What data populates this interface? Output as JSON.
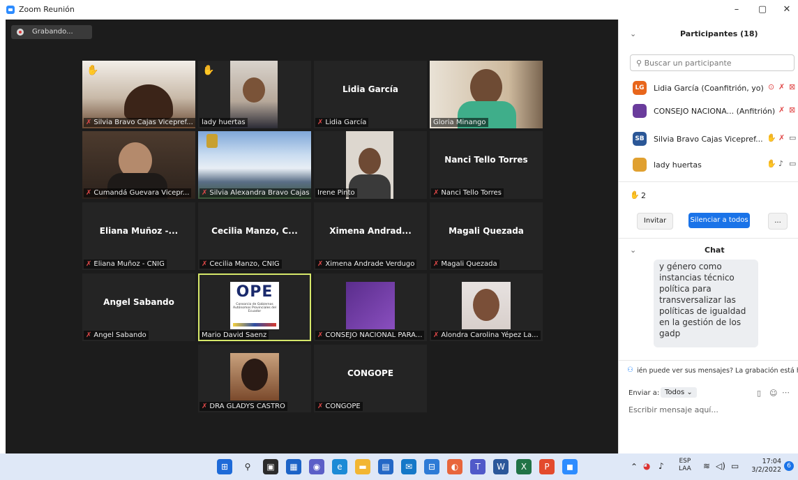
{
  "window": {
    "title": "Zoom Reunión"
  },
  "recording": {
    "label": "Grabando..."
  },
  "tiles": [
    {
      "caption": "Silvia Bravo Cajas Vicepref..."
    },
    {
      "caption": "lady huertas"
    },
    {
      "name": "Lidia García",
      "caption": "Lidia García"
    },
    {
      "caption": "Gloria Minango"
    },
    {
      "caption": "Cumandá Guevara Vicepr..."
    },
    {
      "caption": "Silvia Alexandra Bravo Cajas"
    },
    {
      "caption": "Irene Pinto"
    },
    {
      "name": "Nanci Tello Torres",
      "caption": "Nanci Tello Torres"
    },
    {
      "name": "Eliana Muñoz -...",
      "caption": "Eliana Muñoz - CNIG"
    },
    {
      "name": "Cecilia Manzo, C...",
      "caption": "Cecilia Manzo, CNIG"
    },
    {
      "name": "Ximena Andrad...",
      "caption": "Ximena Andrade Verdugo"
    },
    {
      "name": "Magali Quezada",
      "caption": "Magali Quezada"
    },
    {
      "name": "Angel Sabando",
      "caption": "Angel Sabando"
    },
    {
      "caption": "Mario David Saenz",
      "logo": "OPE",
      "logo_sub": "Consorcio de Gobiernos Autónomos Provinciales del Ecuador"
    },
    {
      "caption": "CONSEJO NACIONAL PARA..."
    },
    {
      "caption": "Alondra Carolina Yépez La..."
    },
    {
      "caption": "DRA GLADYS CASTRO"
    },
    {
      "name": "CONGOPE",
      "caption": "CONGOPE"
    }
  ],
  "panel": {
    "participants_title": "Participantes (18)",
    "search_placeholder": "Buscar un participante",
    "participants": [
      {
        "initials": "LG",
        "name": "Lidia García (Coanfitrión, yo)",
        "color": "#e8661c"
      },
      {
        "initials": "",
        "name": "CONSEJO NACIONA... (Anfitrión)",
        "color": "#6a3c9c"
      },
      {
        "initials": "SB",
        "name": "Silvia Bravo Cajas Vicepref...",
        "color": "#2b5797"
      },
      {
        "initials": "",
        "name": "lady huertas",
        "color": "#e0a030"
      }
    ],
    "hands_count": "2",
    "invite_label": "Invitar",
    "mute_all_label": "Silenciar a todos",
    "more_label": "...",
    "chat_title": "Chat",
    "chat_message": "y género como instancias técnico política para transversalizar las políticas de igualdad en la gestión de los gadp",
    "notice": "ién puede ver sus mensajes? La grabación está habili",
    "send_to_label": "Enviar a:",
    "send_to_value": "Todos",
    "compose_placeholder": "Escribir mensaje aquí..."
  },
  "taskbar": {
    "lang_line1": "ESP",
    "lang_line2": "LAA",
    "time": "17:04",
    "date": "3/2/2022",
    "notification_count": "6"
  },
  "colors": {
    "stage": "#1c1c1c",
    "tile": "#242424",
    "accent": "#2d8cff",
    "muted": "#e04848",
    "hand": "#f2c040"
  }
}
